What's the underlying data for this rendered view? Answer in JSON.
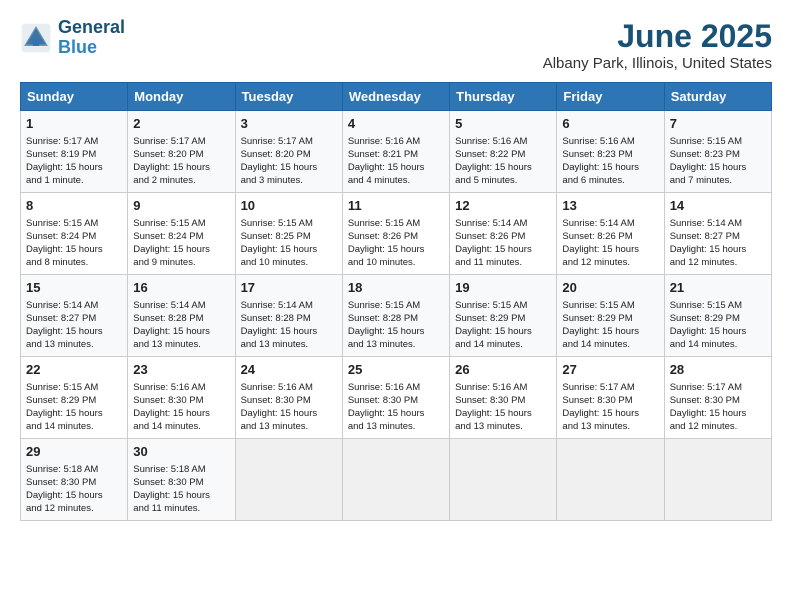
{
  "header": {
    "logo_line1": "General",
    "logo_line2": "Blue",
    "main_title": "June 2025",
    "subtitle": "Albany Park, Illinois, United States"
  },
  "calendar": {
    "days_of_week": [
      "Sunday",
      "Monday",
      "Tuesday",
      "Wednesday",
      "Thursday",
      "Friday",
      "Saturday"
    ],
    "weeks": [
      [
        {
          "day": "",
          "info": "",
          "empty": true
        },
        {
          "day": "",
          "info": "",
          "empty": true
        },
        {
          "day": "",
          "info": "",
          "empty": true
        },
        {
          "day": "",
          "info": "",
          "empty": true
        },
        {
          "day": "",
          "info": "",
          "empty": true
        },
        {
          "day": "",
          "info": "",
          "empty": true
        },
        {
          "day": "",
          "info": "",
          "empty": true
        }
      ],
      [
        {
          "day": "1",
          "info": "Sunrise: 5:17 AM\nSunset: 8:19 PM\nDaylight: 15 hours\nand 1 minute.",
          "empty": false
        },
        {
          "day": "2",
          "info": "Sunrise: 5:17 AM\nSunset: 8:20 PM\nDaylight: 15 hours\nand 2 minutes.",
          "empty": false
        },
        {
          "day": "3",
          "info": "Sunrise: 5:17 AM\nSunset: 8:20 PM\nDaylight: 15 hours\nand 3 minutes.",
          "empty": false
        },
        {
          "day": "4",
          "info": "Sunrise: 5:16 AM\nSunset: 8:21 PM\nDaylight: 15 hours\nand 4 minutes.",
          "empty": false
        },
        {
          "day": "5",
          "info": "Sunrise: 5:16 AM\nSunset: 8:22 PM\nDaylight: 15 hours\nand 5 minutes.",
          "empty": false
        },
        {
          "day": "6",
          "info": "Sunrise: 5:16 AM\nSunset: 8:23 PM\nDaylight: 15 hours\nand 6 minutes.",
          "empty": false
        },
        {
          "day": "7",
          "info": "Sunrise: 5:15 AM\nSunset: 8:23 PM\nDaylight: 15 hours\nand 7 minutes.",
          "empty": false
        }
      ],
      [
        {
          "day": "8",
          "info": "Sunrise: 5:15 AM\nSunset: 8:24 PM\nDaylight: 15 hours\nand 8 minutes.",
          "empty": false
        },
        {
          "day": "9",
          "info": "Sunrise: 5:15 AM\nSunset: 8:24 PM\nDaylight: 15 hours\nand 9 minutes.",
          "empty": false
        },
        {
          "day": "10",
          "info": "Sunrise: 5:15 AM\nSunset: 8:25 PM\nDaylight: 15 hours\nand 10 minutes.",
          "empty": false
        },
        {
          "day": "11",
          "info": "Sunrise: 5:15 AM\nSunset: 8:26 PM\nDaylight: 15 hours\nand 10 minutes.",
          "empty": false
        },
        {
          "day": "12",
          "info": "Sunrise: 5:14 AM\nSunset: 8:26 PM\nDaylight: 15 hours\nand 11 minutes.",
          "empty": false
        },
        {
          "day": "13",
          "info": "Sunrise: 5:14 AM\nSunset: 8:26 PM\nDaylight: 15 hours\nand 12 minutes.",
          "empty": false
        },
        {
          "day": "14",
          "info": "Sunrise: 5:14 AM\nSunset: 8:27 PM\nDaylight: 15 hours\nand 12 minutes.",
          "empty": false
        }
      ],
      [
        {
          "day": "15",
          "info": "Sunrise: 5:14 AM\nSunset: 8:27 PM\nDaylight: 15 hours\nand 13 minutes.",
          "empty": false
        },
        {
          "day": "16",
          "info": "Sunrise: 5:14 AM\nSunset: 8:28 PM\nDaylight: 15 hours\nand 13 minutes.",
          "empty": false
        },
        {
          "day": "17",
          "info": "Sunrise: 5:14 AM\nSunset: 8:28 PM\nDaylight: 15 hours\nand 13 minutes.",
          "empty": false
        },
        {
          "day": "18",
          "info": "Sunrise: 5:15 AM\nSunset: 8:28 PM\nDaylight: 15 hours\nand 13 minutes.",
          "empty": false
        },
        {
          "day": "19",
          "info": "Sunrise: 5:15 AM\nSunset: 8:29 PM\nDaylight: 15 hours\nand 14 minutes.",
          "empty": false
        },
        {
          "day": "20",
          "info": "Sunrise: 5:15 AM\nSunset: 8:29 PM\nDaylight: 15 hours\nand 14 minutes.",
          "empty": false
        },
        {
          "day": "21",
          "info": "Sunrise: 5:15 AM\nSunset: 8:29 PM\nDaylight: 15 hours\nand 14 minutes.",
          "empty": false
        }
      ],
      [
        {
          "day": "22",
          "info": "Sunrise: 5:15 AM\nSunset: 8:29 PM\nDaylight: 15 hours\nand 14 minutes.",
          "empty": false
        },
        {
          "day": "23",
          "info": "Sunrise: 5:16 AM\nSunset: 8:30 PM\nDaylight: 15 hours\nand 14 minutes.",
          "empty": false
        },
        {
          "day": "24",
          "info": "Sunrise: 5:16 AM\nSunset: 8:30 PM\nDaylight: 15 hours\nand 13 minutes.",
          "empty": false
        },
        {
          "day": "25",
          "info": "Sunrise: 5:16 AM\nSunset: 8:30 PM\nDaylight: 15 hours\nand 13 minutes.",
          "empty": false
        },
        {
          "day": "26",
          "info": "Sunrise: 5:16 AM\nSunset: 8:30 PM\nDaylight: 15 hours\nand 13 minutes.",
          "empty": false
        },
        {
          "day": "27",
          "info": "Sunrise: 5:17 AM\nSunset: 8:30 PM\nDaylight: 15 hours\nand 13 minutes.",
          "empty": false
        },
        {
          "day": "28",
          "info": "Sunrise: 5:17 AM\nSunset: 8:30 PM\nDaylight: 15 hours\nand 12 minutes.",
          "empty": false
        }
      ],
      [
        {
          "day": "29",
          "info": "Sunrise: 5:18 AM\nSunset: 8:30 PM\nDaylight: 15 hours\nand 12 minutes.",
          "empty": false
        },
        {
          "day": "30",
          "info": "Sunrise: 5:18 AM\nSunset: 8:30 PM\nDaylight: 15 hours\nand 11 minutes.",
          "empty": false
        },
        {
          "day": "",
          "info": "",
          "empty": true
        },
        {
          "day": "",
          "info": "",
          "empty": true
        },
        {
          "day": "",
          "info": "",
          "empty": true
        },
        {
          "day": "",
          "info": "",
          "empty": true
        },
        {
          "day": "",
          "info": "",
          "empty": true
        }
      ]
    ]
  }
}
